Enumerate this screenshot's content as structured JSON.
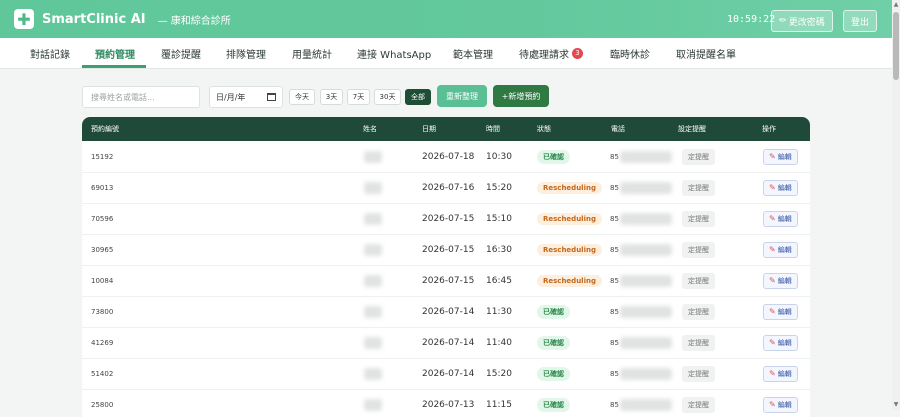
{
  "header": {
    "logo_icon": "plus-cross-icon",
    "app_title": "SmartClinic AI",
    "clinic_name": "— 康和綜合診所",
    "clock": "10:59:22",
    "change_password": "更改密碼",
    "logout": "登出"
  },
  "tabs": [
    {
      "label": "對話記錄"
    },
    {
      "label": "預約管理"
    },
    {
      "label": "覆診提醒"
    },
    {
      "label": "排隊管理"
    },
    {
      "label": "用量統計"
    },
    {
      "label": "連接 WhatsApp"
    },
    {
      "label": "範本管理"
    },
    {
      "label": "待處理請求",
      "badge": "3"
    },
    {
      "label": "臨時休診"
    },
    {
      "label": "取消提醒名單"
    }
  ],
  "filters": {
    "search_placeholder": "搜尋姓名或電話...",
    "date_placeholder": "日/月/年",
    "quick": [
      "今天",
      "3天",
      "7天",
      "30天",
      "全部"
    ],
    "refresh": "重新整理",
    "new_booking": "+新增預約"
  },
  "table": {
    "headers": [
      "預約編號",
      "姓名",
      "日期",
      "時間",
      "狀態",
      "電話",
      "設定提醒",
      "操作"
    ],
    "rows": [
      {
        "id": "15192",
        "date": "2026-07-18",
        "time": "10:30",
        "status": "已確認",
        "phone_prefix": "85",
        "reminder": "定提醒",
        "edit": "編輯"
      },
      {
        "id": "69013",
        "date": "2026-07-16",
        "time": "15:20",
        "status": "Rescheduling",
        "phone_prefix": "85",
        "reminder": "定提醒",
        "edit": "編輯"
      },
      {
        "id": "70596",
        "date": "2026-07-15",
        "time": "15:10",
        "status": "Rescheduling",
        "phone_prefix": "85",
        "reminder": "定提醒",
        "edit": "編輯"
      },
      {
        "id": "30965",
        "date": "2026-07-15",
        "time": "16:30",
        "status": "Rescheduling",
        "phone_prefix": "85",
        "reminder": "定提醒",
        "edit": "編輯"
      },
      {
        "id": "10084",
        "date": "2026-07-15",
        "time": "16:45",
        "status": "Rescheduling",
        "phone_prefix": "85",
        "reminder": "定提醒",
        "edit": "編輯"
      },
      {
        "id": "73800",
        "date": "2026-07-14",
        "time": "11:30",
        "status": "已確認",
        "phone_prefix": "85",
        "reminder": "定提醒",
        "edit": "編輯"
      },
      {
        "id": "41269",
        "date": "2026-07-14",
        "time": "11:40",
        "status": "已確認",
        "phone_prefix": "85",
        "reminder": "定提醒",
        "edit": "編輯"
      },
      {
        "id": "51402",
        "date": "2026-07-14",
        "time": "15:20",
        "status": "已確認",
        "phone_prefix": "85",
        "reminder": "定提醒",
        "edit": "編輯"
      },
      {
        "id": "25800",
        "date": "2026-07-13",
        "time": "11:15",
        "status": "已確認",
        "phone_prefix": "85",
        "reminder": "定提醒",
        "edit": "編輯"
      }
    ]
  },
  "colors": {
    "header_green": "#63c99d",
    "table_header": "#1f4a3a",
    "confirmed": "#2c8a4c",
    "rescheduling": "#c2691e",
    "badge_red": "#e5484d"
  }
}
